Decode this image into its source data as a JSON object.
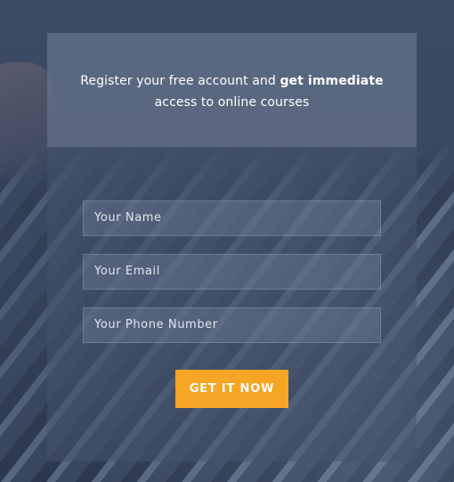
{
  "form": {
    "headline_plain_1": "Register your free account and ",
    "headline_bold": "get immediate",
    "headline_plain_2": "access to online courses",
    "name_placeholder": "Your Name",
    "email_placeholder": "Your Email",
    "phone_placeholder": "Your Phone Number",
    "submit_label": "GET IT NOW"
  },
  "colors": {
    "accent": "#f7a525",
    "text": "#ffffff"
  }
}
